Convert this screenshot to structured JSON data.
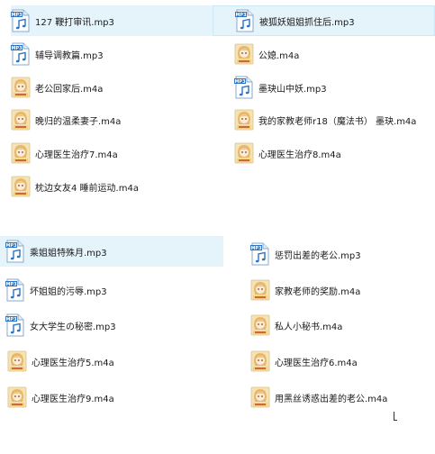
{
  "group_a": {
    "items": [
      {
        "name": "127  鞭打审讯.mp3",
        "icon": "mp3-file-icon"
      },
      {
        "name": "被狐妖姐姐抓住后.mp3",
        "icon": "mp3-file-icon"
      },
      {
        "name": "辅导调教篇.mp3",
        "icon": "mp3-file-icon"
      },
      {
        "name": "公媳.m4a",
        "icon": "m4a-album-art-icon"
      },
      {
        "name": "老公回家后.m4a",
        "icon": "m4a-album-art-icon"
      },
      {
        "name": "墨玦山中妖.mp3",
        "icon": "mp3-file-icon"
      },
      {
        "name": "晚归的温柔妻子.m4a",
        "icon": "m4a-album-art-icon"
      },
      {
        "name": "我的家教老师r18（魔法书） 墨玦.m4a",
        "icon": "m4a-album-art-icon"
      },
      {
        "name": "心理医生治疗7.m4a",
        "icon": "m4a-album-art-icon"
      },
      {
        "name": "心理医生治疗8.m4a",
        "icon": "m4a-album-art-icon"
      },
      {
        "name": "枕边女友4 睡前运动.m4a",
        "icon": "m4a-album-art-icon"
      }
    ]
  },
  "group_b": {
    "items": [
      {
        "name": "乘姐姐特殊月.mp3",
        "icon": "mp3-file-icon"
      },
      {
        "name": "惩罚出差的老公.mp3",
        "icon": "mp3-file-icon"
      },
      {
        "name": "坏姐姐的污辱.mp3",
        "icon": "mp3-file-icon"
      },
      {
        "name": "家教老师的奖励.m4a",
        "icon": "m4a-album-art-icon"
      },
      {
        "name": "女大学生の秘密.mp3",
        "icon": "mp3-file-icon"
      },
      {
        "name": "私人小秘书.m4a",
        "icon": "m4a-album-art-icon"
      },
      {
        "name": "心理医生治疗5.m4a",
        "icon": "m4a-album-art-icon"
      },
      {
        "name": "心理医生治疗6.m4a",
        "icon": "m4a-album-art-icon"
      },
      {
        "name": "心理医生治疗9.m4a",
        "icon": "m4a-album-art-icon"
      },
      {
        "name": "用黑丝诱惑出差的老公.m4a",
        "icon": "m4a-album-art-icon"
      }
    ]
  },
  "icons": {
    "mp3_badge_text": "MP3",
    "album_art_caption": "PROFILE"
  },
  "colors": {
    "selection_bg": "#e5f3fb",
    "selection_border": "#cde8f7",
    "mp3_blue": "#2b73c4",
    "album_bg": "#f6e3b5",
    "album_hair": "#e8b86a"
  }
}
